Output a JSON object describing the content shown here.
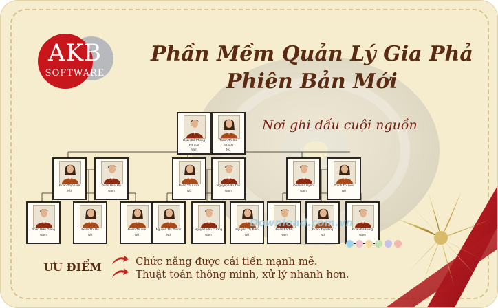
{
  "logo": {
    "brand": "AKB",
    "subtitle": "SOFTWARE"
  },
  "title": {
    "line1": "Phần Mềm Quản Lý Gia Phả",
    "line2": "Phiên Bản Mới"
  },
  "slogan": "Nơi ghi dấu cuội nguồn",
  "tree": {
    "gen1": [
      {
        "name": "Đoàn Bá Phong",
        "gender": "Đã mất",
        "gender2": "Nam",
        "role": "male"
      },
      {
        "name": "Tranh Thị Đa",
        "gender": "Đã mất",
        "gender2": "Nữ",
        "role": "female"
      }
    ],
    "gen2": [
      {
        "name": "Đoàn Thị Vuơn",
        "gender": "Nữ",
        "role": "female"
      },
      {
        "name": "Đoàn Hữu Hải",
        "gender": "Nam",
        "role": "male"
      },
      {
        "name": "Đoàn Thị Lươn",
        "gender": "Nữ",
        "role": "female"
      },
      {
        "name": "Nguyễn Văn Thu",
        "gender": "Nam",
        "role": "male"
      },
      {
        "name": "Đoàn Bá Uyên",
        "gender": "Nam",
        "role": "male"
      },
      {
        "name": "Tranh Thị Lieu",
        "gender": "Nữ",
        "role": "female"
      }
    ],
    "gen3": [
      {
        "name": "Đoàn Hữu Giang",
        "gender": "Nam",
        "role": "male"
      },
      {
        "name": "Đoàn Thị Hà",
        "gender": "Nữ",
        "role": "female"
      },
      {
        "name": "Đoàn Thị Hải",
        "gender": "Nữ",
        "role": "female"
      },
      {
        "name": "Nguyễn Thị Thanh",
        "gender": "Nữ",
        "role": "female"
      },
      {
        "name": "Nguyễn Văn Cường",
        "gender": "Nam",
        "role": "male"
      },
      {
        "name": "Nguyễn Thị Biển",
        "gender": "Nữ",
        "role": "female"
      },
      {
        "name": "Đoàn Bá Tài",
        "gender": "Nam",
        "role": "male"
      },
      {
        "name": "Đoàn Thị Hằng",
        "gender": "Nữ",
        "role": "female"
      },
      {
        "name": "Đoàn Bá Hưng",
        "gender": "Nam",
        "role": "male"
      }
    ]
  },
  "watermark": "Download.com.vn",
  "advantages": {
    "heading": "ƯU ĐIỂM",
    "items": [
      "Chức năng được cải tiến mạnh mẽ.",
      "Thuật toán thông minh, xử lý nhanh hơn."
    ]
  },
  "colors": {
    "background": "#f6edcf",
    "logo_red": "#c8161d",
    "logo_grey": "#b7b9bd",
    "title_brown": "#5a2b12",
    "ribbon_red": "#b3141c",
    "bow_gold": "#c9a64a"
  }
}
